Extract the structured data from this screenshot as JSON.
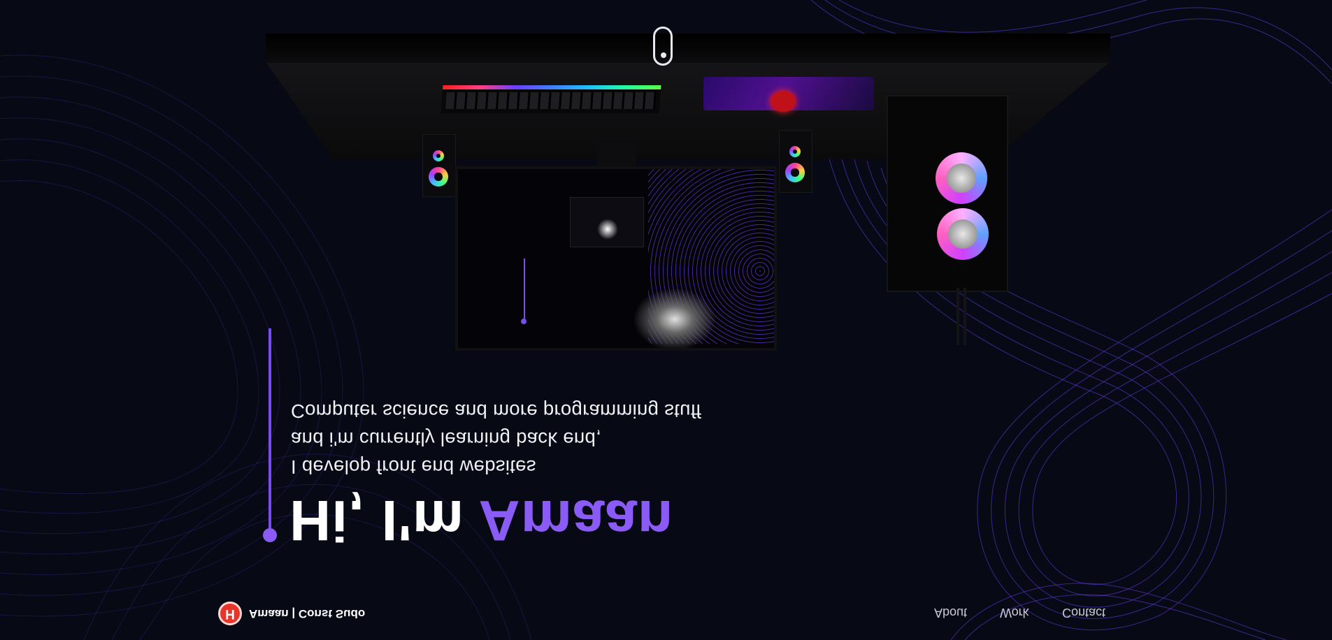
{
  "hero": {
    "greeting": "Hi, I'm ",
    "name": "Amaan",
    "lines": [
      "Computer science and more programming stuff",
      "and i'm currently learning back end,",
      "I develop front end websites"
    ]
  },
  "nav": {
    "brand_logo": "H",
    "brand": "Amaan | Const Sudo",
    "links": [
      "About",
      "Work",
      "Contact"
    ]
  },
  "colors": {
    "background": "#070914",
    "accent": "#8a5cf5",
    "brand_red": "#e8352a"
  },
  "icons": [
    "scroll-mouse-icon",
    "brand-logo-icon"
  ]
}
